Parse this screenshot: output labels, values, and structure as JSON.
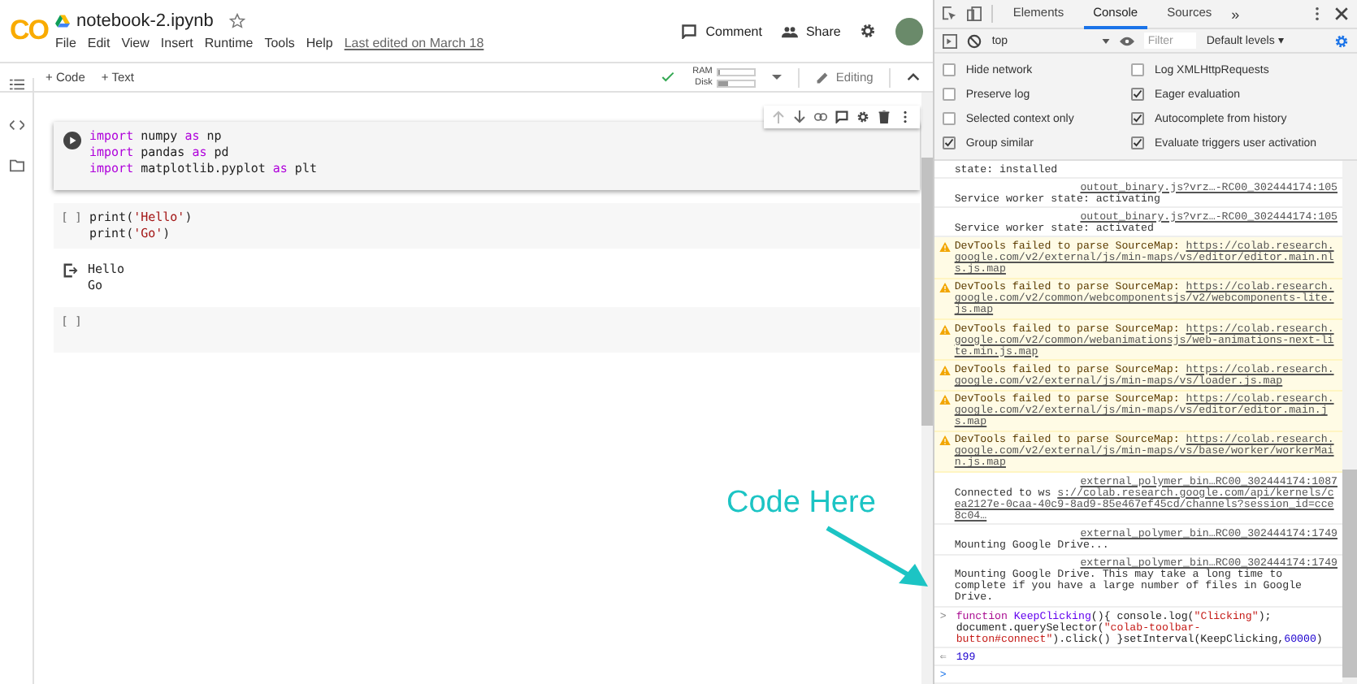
{
  "colab": {
    "logo": "CO",
    "title": "notebook-2.ipynb",
    "menu": [
      "File",
      "Edit",
      "View",
      "Insert",
      "Runtime",
      "Tools",
      "Help"
    ],
    "last_edited": "Last edited on March 18",
    "header_actions": [
      {
        "kind": "comment",
        "label": "Comment"
      },
      {
        "kind": "share",
        "label": "Share"
      }
    ],
    "toolbar": {
      "add": [
        {
          "label": "+ Code"
        },
        {
          "label": "+ Text"
        }
      ],
      "meters": [
        {
          "label": "RAM",
          "level": 0.04
        },
        {
          "label": "Disk",
          "level": 0.25
        }
      ],
      "mode": "Editing"
    },
    "cells": [
      {
        "kind": "code",
        "selected": true,
        "lines": [
          [
            {
              "t": "import",
              "kind": "keyword"
            },
            {
              "t": " numpy ",
              "kind": "plain"
            },
            {
              "t": "as",
              "kind": "keyword"
            },
            {
              "t": " np",
              "kind": "plain"
            }
          ],
          [
            {
              "t": "import",
              "kind": "keyword"
            },
            {
              "t": " pandas ",
              "kind": "plain"
            },
            {
              "t": "as",
              "kind": "keyword"
            },
            {
              "t": " pd",
              "kind": "plain"
            }
          ],
          [
            {
              "t": "import",
              "kind": "keyword"
            },
            {
              "t": " matplotlib.pyplot ",
              "kind": "plain"
            },
            {
              "t": "as",
              "kind": "keyword"
            },
            {
              "t": " plt",
              "kind": "plain"
            }
          ]
        ]
      },
      {
        "kind": "code",
        "selected": false,
        "prompt": "[ ]",
        "lines": [
          [
            {
              "t": "print(",
              "kind": "plain"
            },
            {
              "t": "'Hello'",
              "kind": "string"
            },
            {
              "t": ")",
              "kind": "plain"
            }
          ],
          [
            {
              "t": "print(",
              "kind": "plain"
            },
            {
              "t": "'Go'",
              "kind": "string"
            },
            {
              "t": ")",
              "kind": "plain"
            }
          ]
        ],
        "output": [
          "Hello",
          "Go"
        ]
      },
      {
        "kind": "code",
        "selected": false,
        "prompt": "[ ]"
      }
    ]
  },
  "devtools": {
    "tabs": [
      {
        "label": "Elements",
        "selected": false
      },
      {
        "label": "Console",
        "selected": true
      },
      {
        "label": "Sources",
        "selected": false
      }
    ],
    "more": "»",
    "context": "top",
    "filter": {
      "placeholder": "Filter"
    },
    "levels": "Default levels ▾",
    "settings": [
      {
        "label": "Hide network",
        "checked": false
      },
      {
        "label": "Log XMLHttpRequests",
        "checked": false
      },
      {
        "label": "Preserve log",
        "checked": false
      },
      {
        "label": "Eager evaluation",
        "checked": true
      },
      {
        "label": "Selected context only",
        "checked": false
      },
      {
        "label": "Autocomplete from history",
        "checked": true
      },
      {
        "label": "Group similar",
        "checked": true
      },
      {
        "label": "Evaluate triggers user activation",
        "checked": true
      }
    ],
    "messages": [
      {
        "kind": "info",
        "text": "state: installed"
      },
      {
        "kind": "info",
        "text": "Service worker state: activating",
        "source": "outout_binary.js?vrz…-RC00_302444174:105"
      },
      {
        "kind": "info",
        "text": "Service worker state: activated",
        "source": "outout_binary.js?vrz…-RC00_302444174:105"
      },
      {
        "kind": "warning",
        "text": "DevTools failed to parse SourceMap:",
        "url": "https://colab.research.google.com/v2/external/js/min-maps/vs/editor/editor.main.nls.js.map"
      },
      {
        "kind": "warning",
        "text": "DevTools failed to parse SourceMap:",
        "url": "https://colab.research.google.com/v2/common/webcomponentsjs/v2/webcomponents-lite.js.map"
      },
      {
        "kind": "warning",
        "text": "DevTools failed to parse SourceMap:",
        "url": "https://colab.research.google.com/v2/common/webanimationsjs/web-animations-next-lite.min.js.map"
      },
      {
        "kind": "warning",
        "text": "DevTools failed to parse SourceMap:",
        "url": "https://colab.research.google.com/v2/external/js/min-maps/vs/loader.js.map"
      },
      {
        "kind": "warning",
        "text": "DevTools failed to parse SourceMap:",
        "url": "https://colab.research.google.com/v2/external/js/min-maps/vs/editor/editor.main.js.map"
      },
      {
        "kind": "warning",
        "text": "DevTools failed to parse SourceMap:",
        "url": "https://colab.research.google.com/v2/external/js/min-maps/vs/base/worker/workerMain.js.map"
      },
      {
        "kind": "info",
        "text": "Connected to ws",
        "source": "external_polymer_bin…RC00_302444174:1087",
        "url": "s://colab.research.google.com/api/kernels/cea2127e-0caa-40c9-8ad9-85e467ef45cd/channels?session_id=cce8c04…"
      },
      {
        "kind": "info",
        "text": "Mounting Google Drive...",
        "source": "external_polymer_bin…RC00_302444174:1749"
      },
      {
        "kind": "info",
        "text": "Mounting Google Drive. This may take a long time to complete if you have a large number of files in Google Drive.",
        "source": "external_polymer_bin…RC00_302444174:1749"
      },
      {
        "kind": "input",
        "prefix": ">",
        "tokens": [
          {
            "t": "function",
            "kind": "keyword"
          },
          {
            "t": " KeepClicking",
            "kind": "name"
          },
          {
            "t": "(){ console.log(",
            "kind": "plain"
          },
          {
            "t": "\"Clicking\"",
            "kind": "string"
          },
          {
            "t": "); document.querySelector(",
            "kind": "plain"
          },
          {
            "t": "\"colab-toolbar-button#connect\"",
            "kind": "string"
          },
          {
            "t": ").click() }setInterval(KeepClicking,",
            "kind": "plain"
          },
          {
            "t": "60000",
            "kind": "number"
          },
          {
            "t": ")",
            "kind": "plain"
          }
        ]
      },
      {
        "kind": "result",
        "prefix": "⇐",
        "text": "199"
      },
      {
        "kind": "prompt",
        "prefix": ">"
      }
    ]
  },
  "annotation": {
    "text": "Code Here"
  }
}
